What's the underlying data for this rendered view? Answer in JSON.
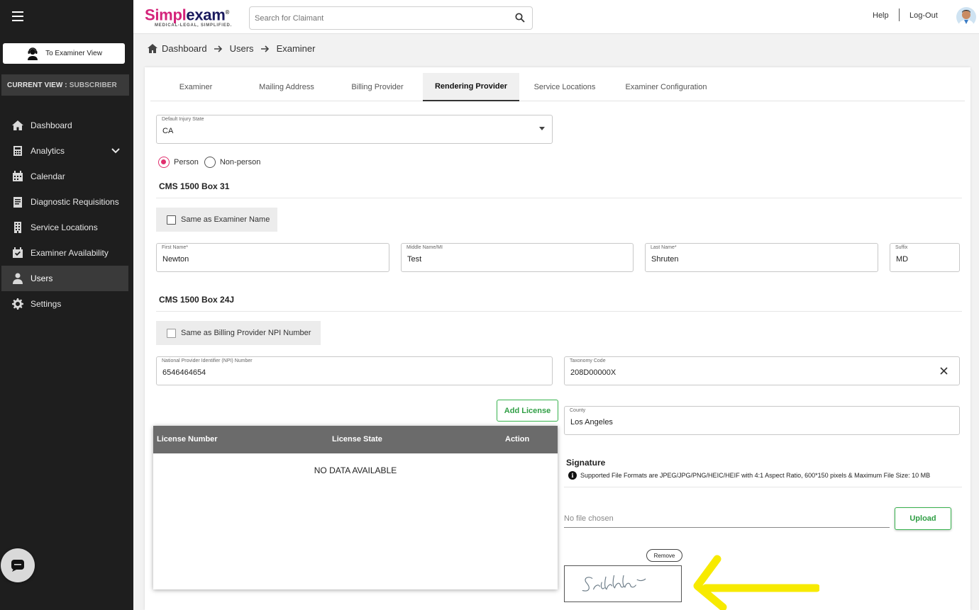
{
  "sidebar": {
    "to_examiner_label": "To Examiner View",
    "current_view_label": "CURRENT VIEW :",
    "current_view_value": "SUBSCRIBER",
    "items": [
      {
        "label": "Dashboard",
        "icon": "home-icon"
      },
      {
        "label": "Analytics",
        "icon": "calculator-icon",
        "expandable": true
      },
      {
        "label": "Calendar",
        "icon": "calendar-icon"
      },
      {
        "label": "Diagnostic Requisitions",
        "icon": "clipboard-icon"
      },
      {
        "label": "Service Locations",
        "icon": "building-icon"
      },
      {
        "label": "Examiner Availability",
        "icon": "calendar-check-icon"
      },
      {
        "label": "Users",
        "icon": "user-icon",
        "active": true
      },
      {
        "label": "Settings",
        "icon": "gear-icon"
      }
    ]
  },
  "topbar": {
    "brand_part1": "Simpl",
    "brand_part2": "exam",
    "brand_reg": "®",
    "tagline": "MEDICAL-LEGAL, SIMPLIFIED.",
    "search_placeholder": "Search for Claimant",
    "help": "Help",
    "logout": "Log-Out"
  },
  "breadcrumb": {
    "items": [
      "Dashboard",
      "Users",
      "Examiner"
    ]
  },
  "tabs": [
    {
      "label": "Examiner"
    },
    {
      "label": "Mailing Address"
    },
    {
      "label": "Billing Provider"
    },
    {
      "label": "Rendering Provider",
      "active": true
    },
    {
      "label": "Service Locations"
    },
    {
      "label": "Examiner Configuration"
    }
  ],
  "form": {
    "injury_state": {
      "label": "Default Injury State",
      "value": "CA"
    },
    "radio": {
      "person": "Person",
      "non_person": "Non-person",
      "selected": "person"
    },
    "box31_title": "CMS 1500 Box 31",
    "same_as_examiner": "Same as Examiner Name",
    "first_name": {
      "label": "First Name*",
      "value": "Newton"
    },
    "middle_name": {
      "label": "Middle Name/MI",
      "value": "Test"
    },
    "last_name": {
      "label": "Last Name*",
      "value": "Shruten"
    },
    "suffix": {
      "label": "Suffix",
      "value": "MD"
    },
    "box24j_title": "CMS 1500 Box 24J",
    "same_as_billing_npi": "Same as Billing Provider NPI Number",
    "npi": {
      "label": "National Provider Identifier (NPI) Number",
      "value": "6546464654"
    },
    "taxonomy": {
      "label": "Taxonomy Code",
      "value": "208D00000X"
    },
    "county": {
      "label": "County",
      "value": "Los Angeles"
    },
    "add_license": "Add License"
  },
  "license_table": {
    "columns": [
      "License Number",
      "License State",
      "Action"
    ],
    "empty": "NO DATA AVAILABLE"
  },
  "signature": {
    "title": "Signature",
    "info": "Supported File Formats are JPEG/JPG/PNG/HEIC/HEIF with 4:1 Aspect Ratio, 600*150 pixels & Maximum File Size: 10 MB",
    "file_status": "No file chosen",
    "upload": "Upload",
    "remove": "Remove"
  },
  "colors": {
    "accent_pink": "#e0306e",
    "green": "#2f9e44",
    "highlight": "#f7ea00"
  }
}
